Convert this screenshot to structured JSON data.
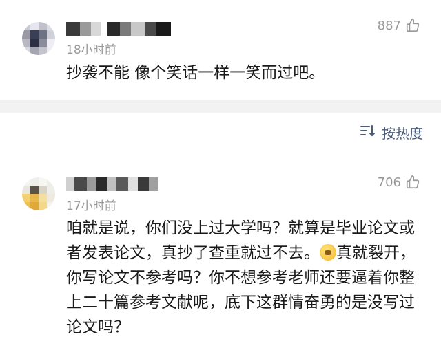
{
  "comments": [
    {
      "time": "18小时前",
      "likes": "887",
      "text": "抄袭不能 像个笑话一样一笑而过吧。"
    },
    {
      "time": "17小时前",
      "likes": "706",
      "text_before_emoji": "咱就是说，你们没上过大学吗？就算是毕业论文或者发表论文，真抄了查重就过不去。",
      "emoji_icon": "facepalm-emoji",
      "text_after_emoji": "真就裂开，你写论文不参考吗？你不想参考老师还要逼着你整上二十篇参考文献呢，底下这群情奋勇的是没写过论文吗？"
    }
  ],
  "sort": {
    "icon": "sort-icon",
    "label": "按热度"
  },
  "colors": {
    "muted": "#999999",
    "sort_accent": "#4d5c7a",
    "divider": "#f2f2f2"
  }
}
